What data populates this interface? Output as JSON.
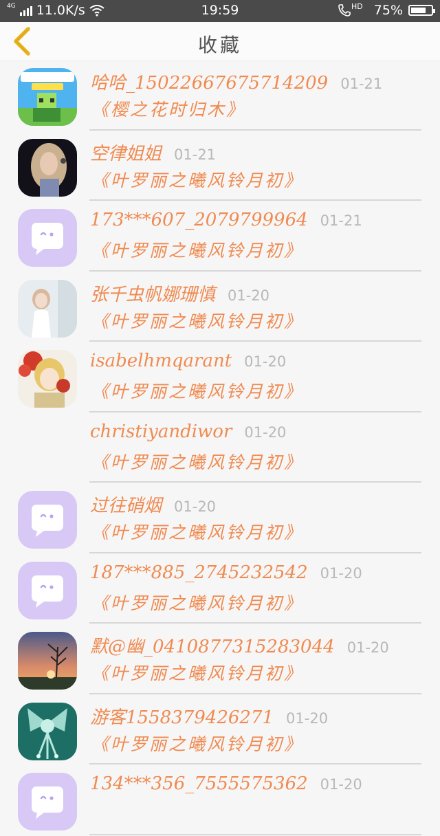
{
  "status_bar": {
    "network": "4G",
    "speed": "11.0K/s",
    "time": "19:59",
    "hd": "HD",
    "battery": "75%",
    "battery_level": 0.75
  },
  "header": {
    "title": "收藏"
  },
  "colors": {
    "accent": "#f08a50",
    "back": "#f0c020",
    "date": "#b8b8b8",
    "placeholder_avatar": "#d8c8f6"
  },
  "items": [
    {
      "name": "哈哈_15022667675714209",
      "date": "01-21",
      "book": "《樱之花时归木》",
      "avatar": "game-cover"
    },
    {
      "name": "空律姐姐",
      "date": "01-21",
      "book": "《叶罗丽之曦风铃月初》",
      "avatar": "photo-singer"
    },
    {
      "name": "173***607_2079799964",
      "date": "01-21",
      "book": "《叶罗丽之曦风铃月初》",
      "avatar": "default-chat"
    },
    {
      "name": "张千虫帆娜珊慎",
      "date": "01-20",
      "book": "《叶罗丽之曦风铃月初》",
      "avatar": "photo-girl"
    },
    {
      "name": "isabelhmqarant",
      "date": "01-20",
      "book": "《叶罗丽之曦风铃月初》",
      "avatar": "anime"
    },
    {
      "name": "christiyandiwor",
      "date": "01-20",
      "book": "《叶罗丽之曦风铃月初》",
      "avatar": "none"
    },
    {
      "name": "过往硝烟",
      "date": "01-20",
      "book": "《叶罗丽之曦风铃月初》",
      "avatar": "default-chat"
    },
    {
      "name": "187***885_2745232542",
      "date": "01-20",
      "book": "《叶罗丽之曦风铃月初》",
      "avatar": "default-chat"
    },
    {
      "name": "默@幽_0410877315283044",
      "date": "01-20",
      "book": "《叶罗丽之曦风铃月初》",
      "avatar": "sunset"
    },
    {
      "name": "游客1558379426271",
      "date": "01-20",
      "book": "《叶罗丽之曦风铃月初》",
      "avatar": "jewelry"
    },
    {
      "name": "134***356_7555575362",
      "date": "01-20",
      "book": "",
      "avatar": "default-chat"
    }
  ]
}
